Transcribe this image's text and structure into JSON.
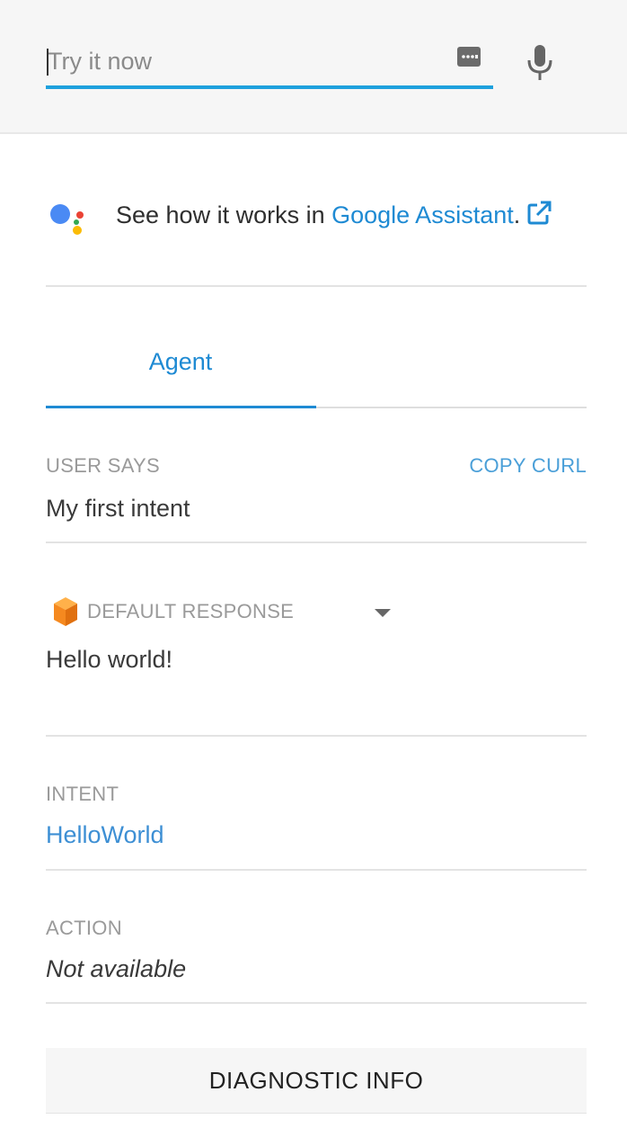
{
  "input": {
    "placeholder": "Try it now",
    "value": ""
  },
  "icons": {
    "keyboard": "keyboard-icon",
    "microphone": "microphone-icon",
    "assistant_logo": "google-assistant-icon",
    "external_link": "external-link-icon",
    "response_cube": "cube-icon",
    "dropdown": "caret-down-icon"
  },
  "assistant_promo": {
    "prefix": "See how it works in ",
    "link_text": "Google Assistant",
    "suffix": "."
  },
  "tabs": [
    {
      "label": "Agent",
      "active": true
    }
  ],
  "user_says": {
    "label": "USER SAYS",
    "action_label": "COPY CURL",
    "value": "My first intent"
  },
  "response": {
    "label": "DEFAULT RESPONSE",
    "value": "Hello world!"
  },
  "intent": {
    "label": "INTENT",
    "value": "HelloWorld"
  },
  "action": {
    "label": "ACTION",
    "value": "Not available"
  },
  "diagnostic": {
    "label": "DIAGNOSTIC INFO"
  },
  "colors": {
    "accent": "#1e8ad3",
    "input_underline": "#1ea1dd",
    "topbar_bg": "#f6f6f6",
    "label_gray": "#9a9a9a",
    "cube_orange": "#f5891f"
  }
}
